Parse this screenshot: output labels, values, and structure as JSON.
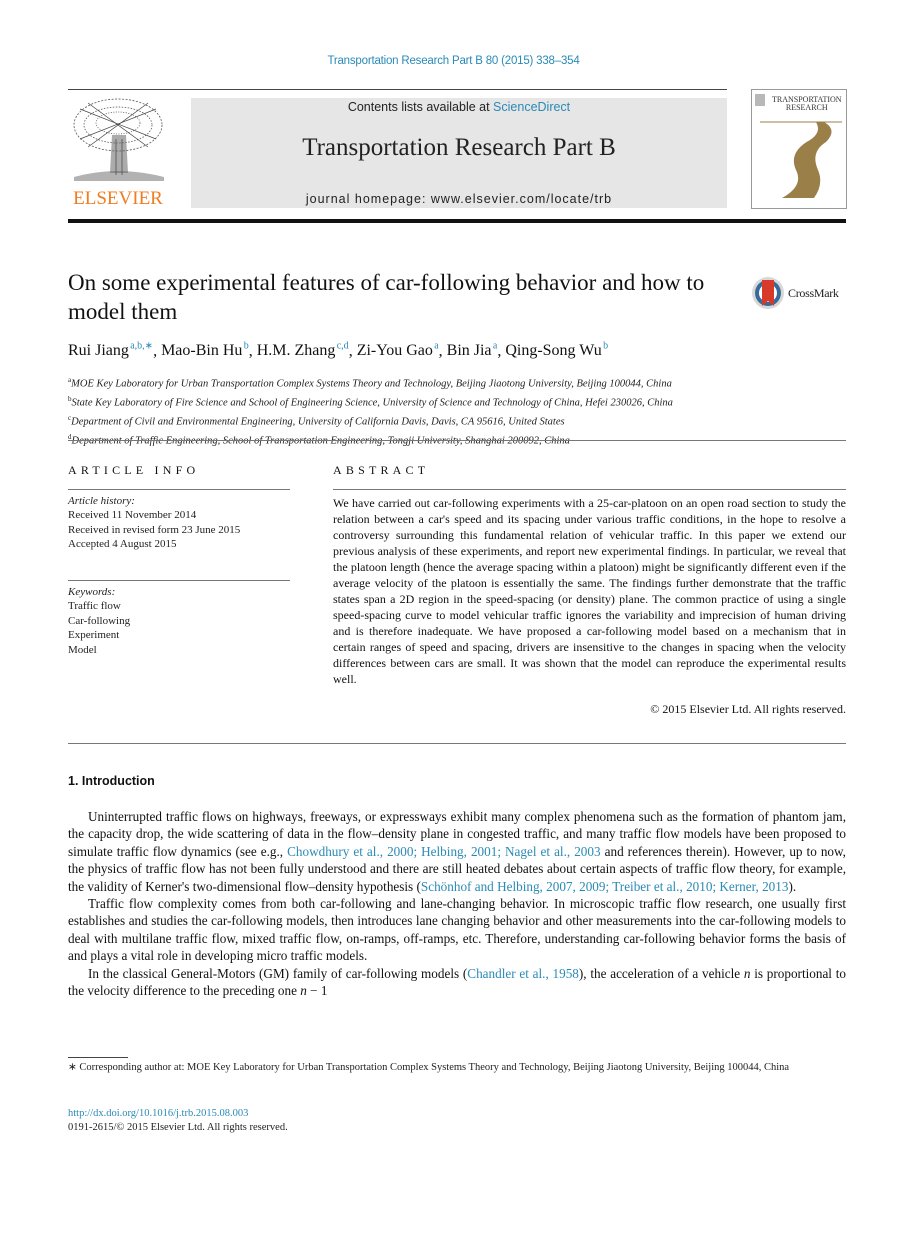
{
  "header": {
    "journal_reference": "Transportation Research Part B 80 (2015) 338–354",
    "contents_prefix": "Contents lists available at ",
    "contents_link": "ScienceDirect",
    "journal_title": "Transportation Research Part B",
    "homepage_line": "journal homepage: www.elsevier.com/locate/trb",
    "publisher_logo_text": "ELSEVIER",
    "cover_title_1": "TRANSPORTATION",
    "cover_title_2": "RESEARCH",
    "brand_orange": "#f07c1f",
    "link_blue": "#2a8ab6",
    "cover_road_color": "#9a8048"
  },
  "article": {
    "title": "On some experimental features of car-following behavior and how to model them",
    "crossmark_label": "CrossMark",
    "authors": [
      {
        "name": "Rui Jiang",
        "sup": "a,b,∗",
        "sep": ", "
      },
      {
        "name": "Mao-Bin Hu",
        "sup": "b",
        "sep": ", "
      },
      {
        "name": "H.M. Zhang",
        "sup": "c,d",
        "sep": ", "
      },
      {
        "name": "Zi-You Gao",
        "sup": "a",
        "sep": ", "
      },
      {
        "name": "Bin Jia",
        "sup": "a",
        "sep": ", "
      },
      {
        "name": "Qing-Song Wu",
        "sup": "b",
        "sep": ""
      }
    ],
    "affiliations": [
      {
        "key": "a",
        "text": "MOE Key Laboratory for Urban Transportation Complex Systems Theory and Technology, Beijing Jiaotong University, Beijing 100044, China"
      },
      {
        "key": "b",
        "text": "State Key Laboratory of Fire Science and School of Engineering Science, University of Science and Technology of China, Hefei 230026, China"
      },
      {
        "key": "c",
        "text": "Department of Civil and Environmental Engineering, University of California Davis, Davis, CA 95616, United States"
      },
      {
        "key": "d",
        "text": "Department of Traffic Engineering, School of Transportation Engineering, Tongji University, Shanghai 200092, China"
      }
    ]
  },
  "article_info": {
    "label": "ARTICLE INFO",
    "history_label": "Article history:",
    "history": [
      "Received 11 November 2014",
      "Received in revised form 23 June 2015",
      "Accepted 4 August 2015"
    ],
    "keywords_label": "Keywords:",
    "keywords": [
      "Traffic flow",
      "Car-following",
      "Experiment",
      "Model"
    ]
  },
  "abstract": {
    "label": "ABSTRACT",
    "text": "We have carried out car-following experiments with a 25-car-platoon on an open road section to study the relation between a car's speed and its spacing under various traffic conditions, in the hope to resolve a controversy surrounding this fundamental relation of vehicular traffic. In this paper we extend our previous analysis of these experiments, and report new experimental findings. In particular, we reveal that the platoon length (hence the average spacing within a platoon) might be significantly different even if the average velocity of the platoon is essentially the same. The findings further demonstrate that the traffic states span a 2D region in the speed-spacing (or density) plane. The common practice of using a single speed-spacing curve to model vehicular traffic ignores the variability and imprecision of human driving and is therefore inadequate. We have proposed a car-following model based on a mechanism that in certain ranges of speed and spacing, drivers are insensitive to the changes in spacing when the velocity differences between cars are small. It was shown that the model can reproduce the experimental results well.",
    "copyright": "© 2015 Elsevier Ltd. All rights reserved."
  },
  "introduction": {
    "heading": "1. Introduction",
    "p1": {
      "t1": "Uninterrupted traffic flows on highways, freeways, or expressways exhibit many complex phenomena such as the formation of phantom jam, the capacity drop, the wide scattering of data in the flow–density plane in congested traffic, and many traffic flow models have been proposed to simulate traffic flow dynamics (see e.g., ",
      "ref1": "Chowdhury et al., 2000; Helbing, 2001; Nagel et al., 2003",
      "t2": " and references therein). However, up to now, the physics of traffic flow has not been fully understood and there are still heated debates about certain aspects of traffic flow theory, for example, the validity of Kerner's two-dimensional flow–density hypothesis (",
      "ref2": "Schönhof and Helbing, 2007, 2009; Treiber et al., 2010; Kerner, 2013",
      "t3": ")."
    },
    "p2": "Traffic flow complexity comes from both car-following and lane-changing behavior. In microscopic traffic flow research, one usually first establishes and studies the car-following models, then introduces lane changing behavior and other measurements into the car-following models to deal with multilane traffic flow, mixed traffic flow, on-ramps, off-ramps, etc. Therefore, understanding car-following behavior forms the basis of and plays a vital role in developing micro traffic models.",
    "p3": {
      "t1": "In the classical General-Motors (GM) family of car-following models (",
      "ref1": "Chandler et al., 1958",
      "t2": "), the acceleration of a vehicle ",
      "var1": "n",
      "t3": " is proportional to the velocity difference to the preceding one ",
      "var2": "n",
      "t4": " − 1"
    }
  },
  "footer": {
    "footnote": "∗ Corresponding author at: MOE Key Laboratory for Urban Transportation Complex Systems Theory and Technology, Beijing Jiaotong University, Beijing 100044, China",
    "doi": "http://dx.doi.org/10.1016/j.trb.2015.08.003",
    "issn_line": "0191-2615/© 2015 Elsevier Ltd. All rights reserved."
  }
}
